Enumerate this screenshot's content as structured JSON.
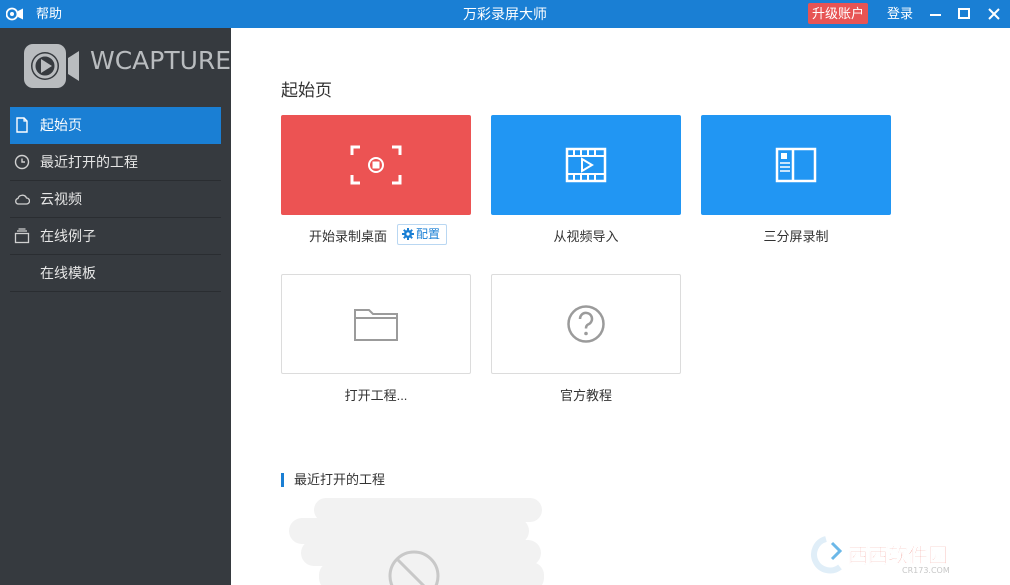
{
  "titlebar": {
    "help": "帮助",
    "title": "万彩录屏大师",
    "upgrade": "升级账户",
    "login": "登录"
  },
  "sidebar": {
    "logo_text": "WCAPTURE",
    "items": [
      {
        "label": "起始页",
        "icon": "page-icon",
        "active": true
      },
      {
        "label": "最近打开的工程",
        "icon": "clock-icon",
        "active": false
      },
      {
        "label": "云视频",
        "icon": "cloud-icon",
        "active": false
      },
      {
        "label": "在线例子",
        "icon": "stack-icon",
        "active": false
      },
      {
        "label": "在线模板",
        "icon": "",
        "active": false
      }
    ]
  },
  "main": {
    "title": "起始页",
    "cards": [
      {
        "label": "开始录制桌面",
        "icon": "record-icon",
        "color": "#ec5353"
      },
      {
        "label": "从视频导入",
        "icon": "film-icon",
        "color": "#2196f3"
      },
      {
        "label": "三分屏录制",
        "icon": "split-screen-icon",
        "color": "#2196f3"
      },
      {
        "label": "打开工程...",
        "icon": "folder-icon",
        "color": "#ffffff"
      },
      {
        "label": "官方教程",
        "icon": "question-icon",
        "color": "#ffffff"
      }
    ],
    "config_label": "配置",
    "recent_title": "最近打开的工程"
  },
  "watermark": {
    "brand": "西西软件园",
    "domain": "CR173.COM"
  },
  "colors": {
    "titlebar": "#1a7fd4",
    "sidebar": "#363a3f",
    "accent": "#1a7fd4",
    "upgrade": "#e75454"
  }
}
